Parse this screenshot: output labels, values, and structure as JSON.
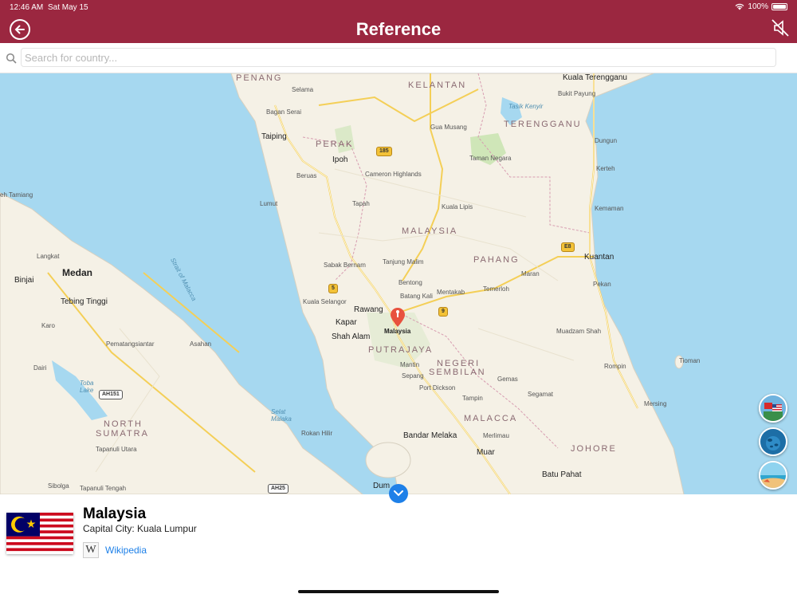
{
  "status_bar": {
    "time": "12:46 AM",
    "date": "Sat May 15",
    "battery": "100%"
  },
  "header": {
    "title": "Reference",
    "back_icon": "back-arrow-icon",
    "mute_icon": "speaker-muted-icon",
    "background": "#9b2740"
  },
  "search": {
    "placeholder": "Search for country...",
    "value": ""
  },
  "map": {
    "pin_label": "Malaysia",
    "places": [
      {
        "key": "penang",
        "text": "PENANG",
        "kind": "region"
      },
      {
        "key": "kelantan",
        "text": "KELANTAN",
        "kind": "region"
      },
      {
        "key": "kuala_terengganu",
        "text": "Kuala Terengganu",
        "kind": "city"
      },
      {
        "key": "selama",
        "text": "Selama",
        "kind": "small"
      },
      {
        "key": "bukit_payung",
        "text": "Bukit Payung",
        "kind": "small"
      },
      {
        "key": "bagan_serai",
        "text": "Bagan Serai",
        "kind": "small"
      },
      {
        "key": "tasik_kenyir",
        "text": "Tasik Kenyir",
        "kind": "water"
      },
      {
        "key": "gua_musang",
        "text": "Gua Musang",
        "kind": "small"
      },
      {
        "key": "terengganu",
        "text": "TERENGGANU",
        "kind": "region"
      },
      {
        "key": "taiping",
        "text": "Taiping",
        "kind": "city"
      },
      {
        "key": "perak",
        "text": "PERAK",
        "kind": "region"
      },
      {
        "key": "dungun",
        "text": "Dungun",
        "kind": "small"
      },
      {
        "key": "ipoh",
        "text": "Ipoh",
        "kind": "city"
      },
      {
        "key": "taman_negara",
        "text": "Taman Negara",
        "kind": "small"
      },
      {
        "key": "kerteh",
        "text": "Kerteh",
        "kind": "small"
      },
      {
        "key": "beruas",
        "text": "Beruas",
        "kind": "small"
      },
      {
        "key": "cameron_highlands",
        "text": "Cameron Highlands",
        "kind": "small"
      },
      {
        "key": "teluk_tamiang",
        "text": "eh Tamiang",
        "kind": "small"
      },
      {
        "key": "lumut",
        "text": "Lumut",
        "kind": "small"
      },
      {
        "key": "tapah",
        "text": "Tapah",
        "kind": "small"
      },
      {
        "key": "kuala_lipis",
        "text": "Kuala Lipis",
        "kind": "small"
      },
      {
        "key": "kemaman",
        "text": "Kemaman",
        "kind": "small"
      },
      {
        "key": "malaysia",
        "text": "MALAYSIA",
        "kind": "region"
      },
      {
        "key": "strait",
        "text": "Strait of Malacca",
        "kind": "water"
      },
      {
        "key": "langkat",
        "text": "Langkat",
        "kind": "small"
      },
      {
        "key": "sabak_bernam",
        "text": "Sabak Bernam",
        "kind": "small"
      },
      {
        "key": "tanjung_malim",
        "text": "Tanjung Malim",
        "kind": "small"
      },
      {
        "key": "pahang",
        "text": "PAHANG",
        "kind": "region"
      },
      {
        "key": "kuantan",
        "text": "Kuantan",
        "kind": "city"
      },
      {
        "key": "binjai",
        "text": "Binjai",
        "kind": "city"
      },
      {
        "key": "medan",
        "text": "Medan",
        "kind": "big"
      },
      {
        "key": "maran",
        "text": "Maran",
        "kind": "small"
      },
      {
        "key": "bentong",
        "text": "Bentong",
        "kind": "small"
      },
      {
        "key": "pekan",
        "text": "Pekan",
        "kind": "small"
      },
      {
        "key": "mentakab",
        "text": "Mentakab",
        "kind": "small"
      },
      {
        "key": "temerloh",
        "text": "Temerloh",
        "kind": "small"
      },
      {
        "key": "batang_kali",
        "text": "Batang Kali",
        "kind": "small"
      },
      {
        "key": "tebing_tinggi",
        "text": "Tebing Tinggi",
        "kind": "city"
      },
      {
        "key": "kuala_selangor",
        "text": "Kuala Selangor",
        "kind": "small"
      },
      {
        "key": "rawang",
        "text": "Rawang",
        "kind": "city"
      },
      {
        "key": "karo",
        "text": "Karo",
        "kind": "small"
      },
      {
        "key": "kapar",
        "text": "Kapar",
        "kind": "city"
      },
      {
        "key": "muadzam_shah",
        "text": "Muadzam Shah",
        "kind": "small"
      },
      {
        "key": "shah_alam",
        "text": "Shah Alam",
        "kind": "city"
      },
      {
        "key": "putrajaya",
        "text": "PUTRAJAYA",
        "kind": "region"
      },
      {
        "key": "pematangsiantar",
        "text": "Pematangsiantar",
        "kind": "small"
      },
      {
        "key": "asahan",
        "text": "Asahan",
        "kind": "small"
      },
      {
        "key": "negeri_sembilan_1",
        "text": "NEGERI",
        "kind": "region"
      },
      {
        "key": "negeri_sembilan_2",
        "text": "SEMBILAN",
        "kind": "region"
      },
      {
        "key": "tioman",
        "text": "Tioman",
        "kind": "small"
      },
      {
        "key": "dairi",
        "text": "Dairi",
        "kind": "small"
      },
      {
        "key": "mantin",
        "text": "Mantin",
        "kind": "small"
      },
      {
        "key": "rompin",
        "text": "Rompin",
        "kind": "small"
      },
      {
        "key": "sepang",
        "text": "Sepang",
        "kind": "small"
      },
      {
        "key": "gemas",
        "text": "Gemas",
        "kind": "small"
      },
      {
        "key": "toba",
        "text": "Toba Lake",
        "kind": "water"
      },
      {
        "key": "port_dickson",
        "text": "Port Dickson",
        "kind": "small"
      },
      {
        "key": "segamat",
        "text": "Segamat",
        "kind": "small"
      },
      {
        "key": "tampin",
        "text": "Tampin",
        "kind": "small"
      },
      {
        "key": "mersing",
        "text": "Mersing",
        "kind": "small"
      },
      {
        "key": "selat_malaka",
        "text": "Selat Malaka",
        "kind": "water"
      },
      {
        "key": "malacca",
        "text": "MALACCA",
        "kind": "region"
      },
      {
        "key": "north_sumatra_1",
        "text": "NORTH",
        "kind": "region"
      },
      {
        "key": "north_sumatra_2",
        "text": "SUMATRA",
        "kind": "region"
      },
      {
        "key": "rokan_hilir",
        "text": "Rokan Hilir",
        "kind": "small"
      },
      {
        "key": "bandar_melaka",
        "text": "Bandar Melaka",
        "kind": "city"
      },
      {
        "key": "merlimau",
        "text": "Merlimau",
        "kind": "small"
      },
      {
        "key": "johore",
        "text": "JOHORE",
        "kind": "region"
      },
      {
        "key": "tapanuli_utara",
        "text": "Tapanuli Utara",
        "kind": "small"
      },
      {
        "key": "muar",
        "text": "Muar",
        "kind": "city"
      },
      {
        "key": "batu_pahat",
        "text": "Batu Pahat",
        "kind": "city"
      },
      {
        "key": "sibolga",
        "text": "Sibolga",
        "kind": "small"
      },
      {
        "key": "tapanuli_tengah",
        "text": "Tapanuli Tengah",
        "kind": "small"
      },
      {
        "key": "dumai",
        "text": "Dum",
        "kind": "city"
      }
    ],
    "shields": [
      "185",
      "E8",
      "5",
      "9",
      "AH151",
      "AH25"
    ]
  },
  "side_buttons": [
    {
      "name": "flags-mode-button",
      "icon": "flags-icon"
    },
    {
      "name": "ocean-mode-button",
      "icon": "ocean-icon"
    },
    {
      "name": "beach-mode-button",
      "icon": "beach-icon"
    }
  ],
  "country": {
    "name": "Malaysia",
    "capital_line": "Capital City: Kuala Lumpur",
    "link_label": "Wikipedia",
    "link_icon": "wikipedia-icon",
    "flag_icon": "malaysia-flag"
  },
  "colors": {
    "link": "#1e80e8",
    "map_water": "#a6d8f0",
    "map_land": "#f5f1e6",
    "pin": "#e8513e"
  }
}
